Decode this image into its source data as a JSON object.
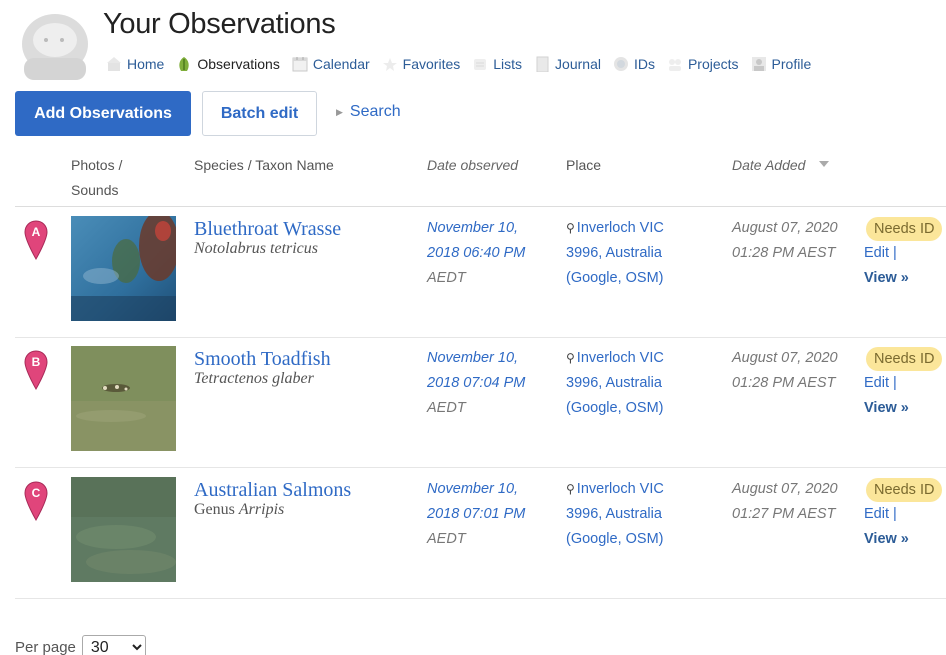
{
  "page": {
    "title": "Your Observations"
  },
  "nav": {
    "items": [
      {
        "label": "Home",
        "icon": "home-icon",
        "active": false
      },
      {
        "label": "Observations",
        "icon": "observations-icon",
        "active": true
      },
      {
        "label": "Calendar",
        "icon": "calendar-icon",
        "active": false
      },
      {
        "label": "Favorites",
        "icon": "favorites-icon",
        "active": false
      },
      {
        "label": "Lists",
        "icon": "lists-icon",
        "active": false
      },
      {
        "label": "Journal",
        "icon": "journal-icon",
        "active": false
      },
      {
        "label": "IDs",
        "icon": "ids-icon",
        "active": false
      },
      {
        "label": "Projects",
        "icon": "projects-icon",
        "active": false
      },
      {
        "label": "Profile",
        "icon": "profile-icon",
        "active": false
      }
    ]
  },
  "toolbar": {
    "add_label": "Add Observations",
    "batch_label": "Batch edit",
    "search_label": "Search"
  },
  "table": {
    "headers": {
      "photos_line1": "Photos /",
      "photos_line2": "Sounds",
      "species": "Species / Taxon Name",
      "date_observed": "Date observed",
      "place": "Place",
      "date_added": "Date Added"
    },
    "rows": [
      {
        "marker": "A",
        "common_name": "Bluethroat Wrasse",
        "sci_prefix": "",
        "sci_name": "Notolabrus tetricus",
        "date_line1": "November 10,",
        "date_line2": "2018 06:40 PM",
        "date_line3": "AEDT",
        "place_line1": "Inverloch VIC",
        "place_line2": "3996, Australia",
        "place_line3": "(Google, OSM)",
        "added_line1": "August 07, 2020",
        "added_line2": "01:28 PM AEST",
        "status": "Needs ID",
        "edit_label": "Edit |",
        "view_label": "View »"
      },
      {
        "marker": "B",
        "common_name": "Smooth Toadfish",
        "sci_prefix": "",
        "sci_name": "Tetractenos glaber",
        "date_line1": "November 10,",
        "date_line2": "2018 07:04 PM",
        "date_line3": "AEDT",
        "place_line1": "Inverloch VIC",
        "place_line2": "3996, Australia",
        "place_line3": "(Google, OSM)",
        "added_line1": "August 07, 2020",
        "added_line2": "01:28 PM AEST",
        "status": "Needs ID",
        "edit_label": "Edit |",
        "view_label": "View »"
      },
      {
        "marker": "C",
        "common_name": "Australian Salmons",
        "sci_prefix": "Genus ",
        "sci_name": "Arripis",
        "date_line1": "November 10,",
        "date_line2": "2018 07:01 PM",
        "date_line3": "AEDT",
        "place_line1": "Inverloch VIC",
        "place_line2": "3996, Australia",
        "place_line3": "(Google, OSM)",
        "added_line1": "August 07, 2020",
        "added_line2": "01:27 PM AEST",
        "status": "Needs ID",
        "edit_label": "Edit |",
        "view_label": "View »"
      }
    ]
  },
  "pagination": {
    "per_page_label": "Per page",
    "per_page_value": "30"
  },
  "colors": {
    "link": "#2f6ac5",
    "primary_button": "#2f6ac5",
    "badge_bg": "#fbe69a",
    "marker": "#e0457b"
  }
}
